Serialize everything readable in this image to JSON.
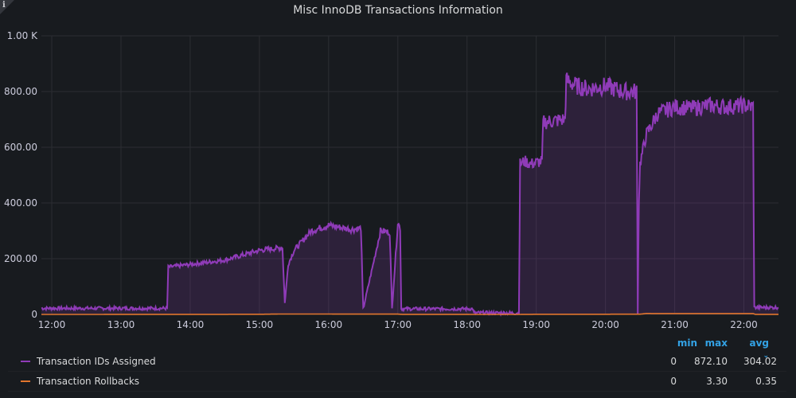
{
  "panel": {
    "title": "Misc InnoDB Transactions Information",
    "info_icon": "info-icon"
  },
  "chart_data": {
    "type": "area",
    "title": "Misc InnoDB Transactions Information",
    "x_ticks": [
      "12:00",
      "13:00",
      "14:00",
      "15:00",
      "16:00",
      "17:00",
      "18:00",
      "19:00",
      "20:00",
      "21:00",
      "22:00"
    ],
    "y_ticks": [
      "0",
      "200.00",
      "400.00",
      "600.00",
      "800.00",
      "1.00 K"
    ],
    "xlim": [
      "11:51",
      "22:30"
    ],
    "ylim": [
      0,
      1000
    ],
    "grid": true,
    "legend_placement": "bottom",
    "series": [
      {
        "name": "Transaction IDs Assigned",
        "color": "#8f3bb8",
        "fill": true,
        "x": [
          "11:51",
          "13:40",
          "13:41",
          "14:30",
          "15:00",
          "15:20",
          "15:22",
          "15:25",
          "15:30",
          "15:45",
          "16:00",
          "16:20",
          "16:28",
          "16:30",
          "16:45",
          "16:53",
          "16:55",
          "17:00",
          "17:02",
          "17:03",
          "18:05",
          "18:06",
          "18:45",
          "18:46",
          "18:50",
          "18:55",
          "19:05",
          "19:06",
          "19:25",
          "19:26",
          "19:35",
          "19:45",
          "20:00",
          "20:15",
          "20:27",
          "20:28",
          "20:29",
          "20:30",
          "20:35",
          "20:45",
          "21:00",
          "21:15",
          "21:30",
          "21:45",
          "22:00",
          "22:08",
          "22:09",
          "22:30"
        ],
        "y": [
          22,
          22,
          170,
          195,
          230,
          240,
          40,
          180,
          230,
          300,
          320,
          305,
          310,
          20,
          300,
          295,
          20,
          330,
          310,
          20,
          20,
          5,
          5,
          540,
          550,
          540,
          550,
          690,
          700,
          840,
          820,
          810,
          820,
          800,
          800,
          5,
          420,
          540,
          640,
          720,
          745,
          740,
          750,
          745,
          750,
          745,
          25,
          25
        ]
      },
      {
        "name": "Transaction Rollbacks",
        "color": "#e0752d",
        "fill": false,
        "x": [
          "11:51",
          "15:00",
          "15:20",
          "17:00",
          "17:05",
          "18:45",
          "19:00",
          "20:30",
          "20:35",
          "22:08",
          "22:10",
          "22:30"
        ],
        "y": [
          0,
          0.5,
          1.5,
          1,
          0.2,
          0.1,
          0.5,
          0.8,
          3.3,
          3,
          0.3,
          0.2
        ],
        "stats": {
          "min": "0",
          "max": "3.30",
          "avg": "0.35"
        }
      }
    ]
  },
  "legend": {
    "headers": {
      "min": "min",
      "max": "max",
      "avg": "avg"
    },
    "rows": [
      {
        "name": "Transaction IDs Assigned",
        "color": "#8f3bb8",
        "min": "0",
        "max": "872.10",
        "avg": "304.02"
      },
      {
        "name": "Transaction Rollbacks",
        "color": "#e0752d",
        "min": "0",
        "max": "3.30",
        "avg": "0.35"
      }
    ]
  }
}
